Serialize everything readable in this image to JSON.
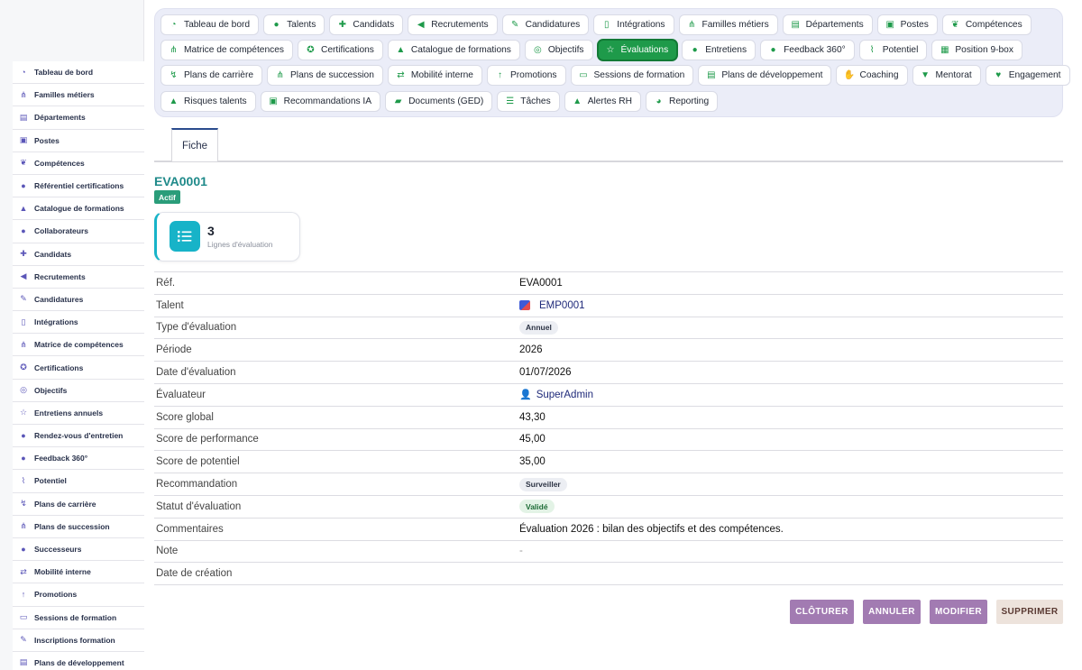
{
  "sidebar": {
    "items": [
      {
        "label": "Tableau de bord",
        "icon": "dashboard-icon"
      },
      {
        "label": "Familles métiers",
        "icon": "hierarchy-icon"
      },
      {
        "label": "Départements",
        "icon": "building-icon"
      },
      {
        "label": "Postes",
        "icon": "id-badge-icon"
      },
      {
        "label": "Compétences",
        "icon": "brain-icon"
      },
      {
        "label": "Référentiel certifications",
        "icon": "certificate-icon"
      },
      {
        "label": "Catalogue de formations",
        "icon": "graduation-cap-icon"
      },
      {
        "label": "Collaborateurs",
        "icon": "user-icon"
      },
      {
        "label": "Candidats",
        "icon": "user-plus-icon"
      },
      {
        "label": "Recrutements",
        "icon": "megaphone-icon"
      },
      {
        "label": "Candidatures",
        "icon": "file-signature-icon"
      },
      {
        "label": "Intégrations",
        "icon": "door-open-icon"
      },
      {
        "label": "Matrice de compétences",
        "icon": "sitemap-icon"
      },
      {
        "label": "Certifications",
        "icon": "award-icon"
      },
      {
        "label": "Objectifs",
        "icon": "target-icon"
      },
      {
        "label": "Entretiens annuels",
        "icon": "star-icon"
      },
      {
        "label": "Rendez-vous d'entretien",
        "icon": "comments-icon"
      },
      {
        "label": "Feedback 360°",
        "icon": "comment-dots-icon"
      },
      {
        "label": "Potentiel",
        "icon": "chart-line-icon"
      },
      {
        "label": "Plans de carrière",
        "icon": "route-icon"
      },
      {
        "label": "Plans de succession",
        "icon": "sitemap-icon"
      },
      {
        "label": "Successeurs",
        "icon": "users-icon"
      },
      {
        "label": "Mobilité interne",
        "icon": "exchange-icon"
      },
      {
        "label": "Promotions",
        "icon": "arrow-up-icon"
      },
      {
        "label": "Sessions de formation",
        "icon": "chalkboard-icon"
      },
      {
        "label": "Inscriptions formation",
        "icon": "user-edit-icon"
      },
      {
        "label": "Plans de développement",
        "icon": "clipboard-icon"
      }
    ]
  },
  "modules": {
    "rows": [
      [
        {
          "label": "Tableau de bord",
          "icon": "dashboard-icon"
        },
        {
          "label": "Talents",
          "icon": "user-icon"
        },
        {
          "label": "Candidats",
          "icon": "user-plus-icon"
        },
        {
          "label": "Recrutements",
          "icon": "megaphone-icon"
        },
        {
          "label": "Candidatures",
          "icon": "file-signature-icon"
        },
        {
          "label": "Intégrations",
          "icon": "door-open-icon"
        },
        {
          "label": "Familles métiers",
          "icon": "hierarchy-icon"
        },
        {
          "label": "Départements",
          "icon": "building-icon"
        },
        {
          "label": "Postes",
          "icon": "id-badge-icon"
        },
        {
          "label": "Compétences",
          "icon": "brain-icon"
        }
      ],
      [
        {
          "label": "Matrice de compétences",
          "icon": "sitemap-icon"
        },
        {
          "label": "Certifications",
          "icon": "award-icon"
        },
        {
          "label": "Catalogue de formations",
          "icon": "graduation-cap-icon"
        },
        {
          "label": "Objectifs",
          "icon": "target-icon"
        },
        {
          "label": "Évaluations",
          "icon": "star-icon",
          "active": true
        },
        {
          "label": "Entretiens",
          "icon": "comments-icon"
        },
        {
          "label": "Feedback 360°",
          "icon": "comment-dots-icon"
        },
        {
          "label": "Potentiel",
          "icon": "chart-line-icon"
        },
        {
          "label": "Position 9-box",
          "icon": "grid-icon"
        }
      ],
      [
        {
          "label": "Plans de carrière",
          "icon": "route-icon"
        },
        {
          "label": "Plans de succession",
          "icon": "sitemap-icon"
        },
        {
          "label": "Mobilité interne",
          "icon": "exchange-icon"
        },
        {
          "label": "Promotions",
          "icon": "arrow-up-icon"
        },
        {
          "label": "Sessions de formation",
          "icon": "chalkboard-icon"
        },
        {
          "label": "Plans de développement",
          "icon": "clipboard-icon"
        },
        {
          "label": "Coaching",
          "icon": "handshake-icon"
        },
        {
          "label": "Mentorat",
          "icon": "user-tie-icon"
        },
        {
          "label": "Engagement",
          "icon": "heart-icon"
        }
      ],
      [
        {
          "label": "Risques talents",
          "icon": "warning-icon"
        },
        {
          "label": "Recommandations IA",
          "icon": "robot-icon"
        },
        {
          "label": "Documents (GED)",
          "icon": "folder-open-icon"
        },
        {
          "label": "Tâches",
          "icon": "tasks-icon"
        },
        {
          "label": "Alertes RH",
          "icon": "bell-icon"
        },
        {
          "label": "Reporting",
          "icon": "pie-chart-icon"
        }
      ]
    ]
  },
  "tabs": {
    "active_label": "Fiche"
  },
  "record": {
    "title": "EVA0001",
    "status": "Actif",
    "stat": {
      "value": "3",
      "label": "Lignes d'évaluation",
      "icon": "list-icon"
    }
  },
  "details": {
    "rows": [
      {
        "label": "Réf.",
        "value": "EVA0001",
        "type": "text"
      },
      {
        "label": "Talent",
        "value": "EMP0001",
        "type": "link"
      },
      {
        "label": "Type d'évaluation",
        "value": "Annuel",
        "type": "pill"
      },
      {
        "label": "Période",
        "value": "2026",
        "type": "text"
      },
      {
        "label": "Date d'évaluation",
        "value": "01/07/2026",
        "type": "text"
      },
      {
        "label": "Évaluateur",
        "value": "SuperAdmin",
        "type": "user"
      },
      {
        "label": "Score global",
        "value": "43,30",
        "type": "text"
      },
      {
        "label": "Score de performance",
        "value": "45,00",
        "type": "text"
      },
      {
        "label": "Score de potentiel",
        "value": "35,00",
        "type": "text"
      },
      {
        "label": "Recommandation",
        "value": "Surveiller",
        "type": "pill"
      },
      {
        "label": "Statut d'évaluation",
        "value": "Validé",
        "type": "pill-green"
      },
      {
        "label": "Commentaires",
        "value": "Évaluation 2026 : bilan des objectifs et des compétences.",
        "type": "text"
      },
      {
        "label": "Note",
        "value": "-",
        "type": "muted"
      },
      {
        "label": "Date de création",
        "value": "",
        "type": "text"
      }
    ]
  },
  "actions": {
    "close_label": "CLÔTURER",
    "cancel_label": "ANNULER",
    "edit_label": "MODIFIER",
    "delete_label": "SUPPRIMER"
  },
  "colors": {
    "accent_green": "#1e9a4a",
    "action_purple": "#a27bb2",
    "title_teal": "#1f8a8a",
    "stat_cyan": "#17b3c8"
  }
}
